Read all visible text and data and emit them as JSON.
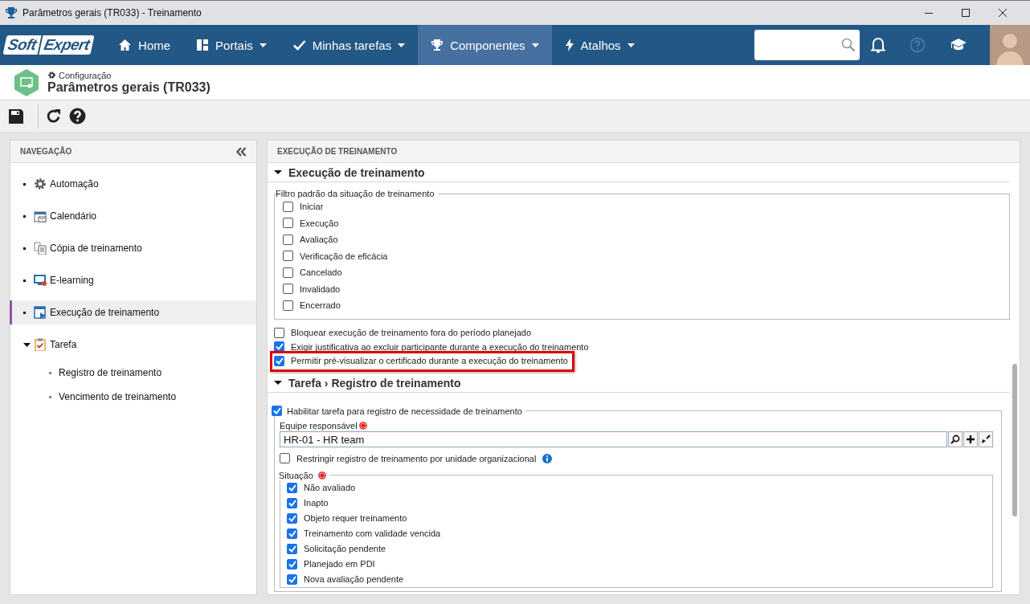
{
  "window": {
    "title": "Parâmetros gerais (TR033) - Treinamento"
  },
  "topnav": {
    "logo": [
      "Soft",
      "Expert"
    ],
    "items": [
      {
        "label": "Home",
        "kind": "home",
        "dropdown": false,
        "selected": false
      },
      {
        "label": "Portais",
        "kind": "portal",
        "dropdown": true,
        "selected": false
      },
      {
        "label": "Minhas tarefas",
        "kind": "check",
        "dropdown": true,
        "selected": false
      },
      {
        "label": "Componentes",
        "kind": "trophy",
        "dropdown": true,
        "selected": true
      },
      {
        "label": "Atalhos",
        "kind": "bolt",
        "dropdown": true,
        "selected": false
      }
    ]
  },
  "header": {
    "breadcrumb": "Configuração",
    "title": "Parâmetros gerais (TR033)"
  },
  "sidebar": {
    "title": "NAVEGAÇÃO",
    "items": [
      {
        "label": "Automação",
        "kind": "gear",
        "selected": false
      },
      {
        "label": "Calendário",
        "kind": "calendar",
        "selected": false
      },
      {
        "label": "Cópia de treinamento",
        "kind": "copy",
        "selected": false
      },
      {
        "label": "E-learning",
        "kind": "elearning",
        "selected": false
      },
      {
        "label": "Execução de treinamento",
        "kind": "play",
        "selected": true
      },
      {
        "label": "Tarefa",
        "kind": "task",
        "selected": false,
        "expanded": true,
        "children": [
          {
            "label": "Registro de treinamento",
            "selected": false
          },
          {
            "label": "Vencimento de treinamento",
            "selected": false
          }
        ]
      }
    ]
  },
  "main": {
    "title": "EXECUÇÃO DE TREINAMENTO",
    "sections": [
      {
        "title": "Execução de treinamento",
        "expanded": true,
        "blocks": [
          {
            "kind": "fieldset",
            "legend": "Filtro padrão da situação de treinamento",
            "options": [
              {
                "label": "Iniciar",
                "checked": false
              },
              {
                "label": "Execução",
                "checked": false
              },
              {
                "label": "Avaliação",
                "checked": false
              },
              {
                "label": "Verificação de eficácia",
                "checked": false
              },
              {
                "label": "Cancelado",
                "checked": false
              },
              {
                "label": "Invalidado",
                "checked": false
              },
              {
                "label": "Encerrado",
                "checked": false
              }
            ]
          },
          {
            "kind": "checkbox",
            "label": "Bloquear execução de treinamento fora do período planejado",
            "checked": false,
            "highlighted": false
          },
          {
            "kind": "checkbox",
            "label": "Exigir justificativa ao excluir participante durante a execução do treinamento",
            "checked": true,
            "highlighted": false
          },
          {
            "kind": "checkbox",
            "label": "Permitir pré-visualizar o certificado durante a execução do treinamento",
            "checked": true,
            "highlighted": true
          }
        ]
      },
      {
        "title": "Tarefa › Registro de treinamento",
        "expanded": true,
        "blocks": [
          {
            "kind": "checkgroup",
            "legend": "Habilitar tarefa para registro de necessidade de treinamento",
            "checked": true,
            "blocks": [
              {
                "kind": "lookup",
                "label": "Equipe responsável",
                "required": true,
                "value": "HR-01 - HR team"
              },
              {
                "kind": "checkbox",
                "label": "Restringir registro de treinamento por unidade organizacional",
                "checked": false,
                "highlighted": false,
                "info": true
              },
              {
                "kind": "fieldset",
                "legend": "Situação",
                "required": true,
                "options": [
                  {
                    "label": "Não avaliado",
                    "checked": true
                  },
                  {
                    "label": "Inapto",
                    "checked": true
                  },
                  {
                    "label": "Objeto requer treinamento",
                    "checked": true
                  },
                  {
                    "label": "Treinamento com validade vencida",
                    "checked": true
                  },
                  {
                    "label": "Solicitação pendente",
                    "checked": true
                  },
                  {
                    "label": "Planejado em PDI",
                    "checked": true
                  },
                  {
                    "label": "Nova avaliação pendente",
                    "checked": true
                  }
                ]
              }
            ]
          }
        ]
      }
    ]
  }
}
